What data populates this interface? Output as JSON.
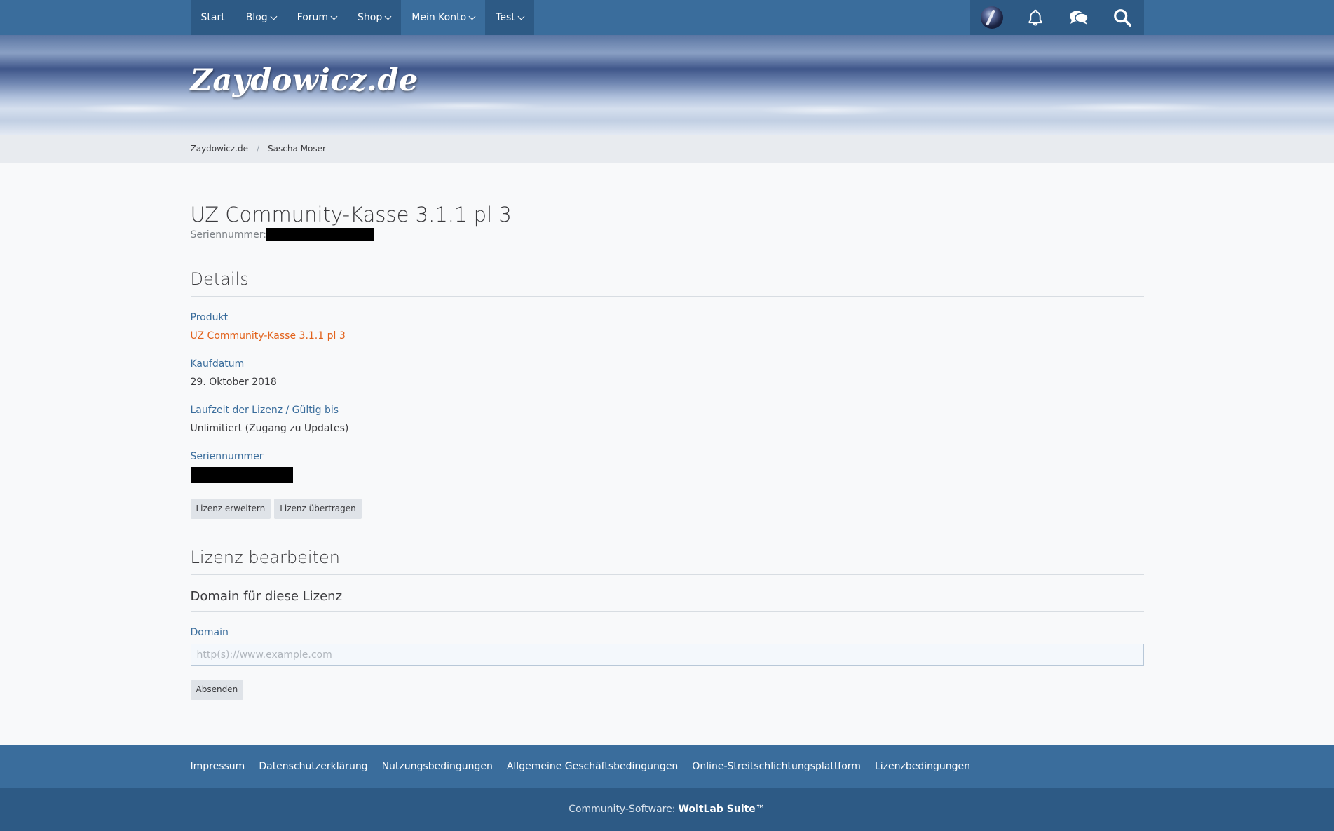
{
  "nav": {
    "items": [
      {
        "label": "Start",
        "has_dropdown": false,
        "active": false
      },
      {
        "label": "Blog",
        "has_dropdown": true,
        "active": false
      },
      {
        "label": "Forum",
        "has_dropdown": true,
        "active": false
      },
      {
        "label": "Shop",
        "has_dropdown": true,
        "active": false
      },
      {
        "label": "Mein Konto",
        "has_dropdown": true,
        "active": true
      },
      {
        "label": "Test",
        "has_dropdown": true,
        "active": false
      }
    ],
    "user_icons": [
      "avatar",
      "bell-icon",
      "conversations-icon",
      "search-icon"
    ]
  },
  "site": {
    "logo_text": "Zaydowicz.de"
  },
  "breadcrumb": {
    "items": [
      "Zaydowicz.de",
      "Sascha Moser"
    ],
    "separator": "/"
  },
  "license": {
    "title": "UZ Community-Kasse 3.1.1 pl 3",
    "serial_label": "Seriennummer:"
  },
  "details": {
    "heading": "Details",
    "product_label": "Produkt",
    "product_value": "UZ Community-Kasse 3.1.1 pl 3",
    "purchase_label": "Kaufdatum",
    "purchase_value": "29. Oktober 2018",
    "term_label": "Laufzeit der Lizenz / Gültig bis",
    "term_value": "Unlimitiert (Zugang zu Updates)",
    "serial_label": "Seriennummer",
    "buttons": {
      "extend": "Lizenz erweitern",
      "transfer": "Lizenz übertragen"
    }
  },
  "edit": {
    "heading": "Lizenz bearbeiten",
    "subheading": "Domain für diese Lizenz",
    "domain_label": "Domain",
    "domain_value": "",
    "domain_placeholder": "http(s)://www.example.com",
    "submit_label": "Absenden"
  },
  "footer": {
    "links": [
      "Impressum",
      "Datenschutzerklärung",
      "Nutzungsbedingungen",
      "Allgemeine Geschäftsbedingungen",
      "Online-Streitschlichtungsplattform",
      "Lizenzbedingungen"
    ],
    "copyright_prefix": "Community-Software:",
    "copyright_brand": "WoltLab Suite™"
  },
  "colors": {
    "nav_bg": "#3a6d9c",
    "nav_dark": "#2d5a85",
    "accent_link": "#3a6d9c",
    "product_link": "#e2621b"
  }
}
